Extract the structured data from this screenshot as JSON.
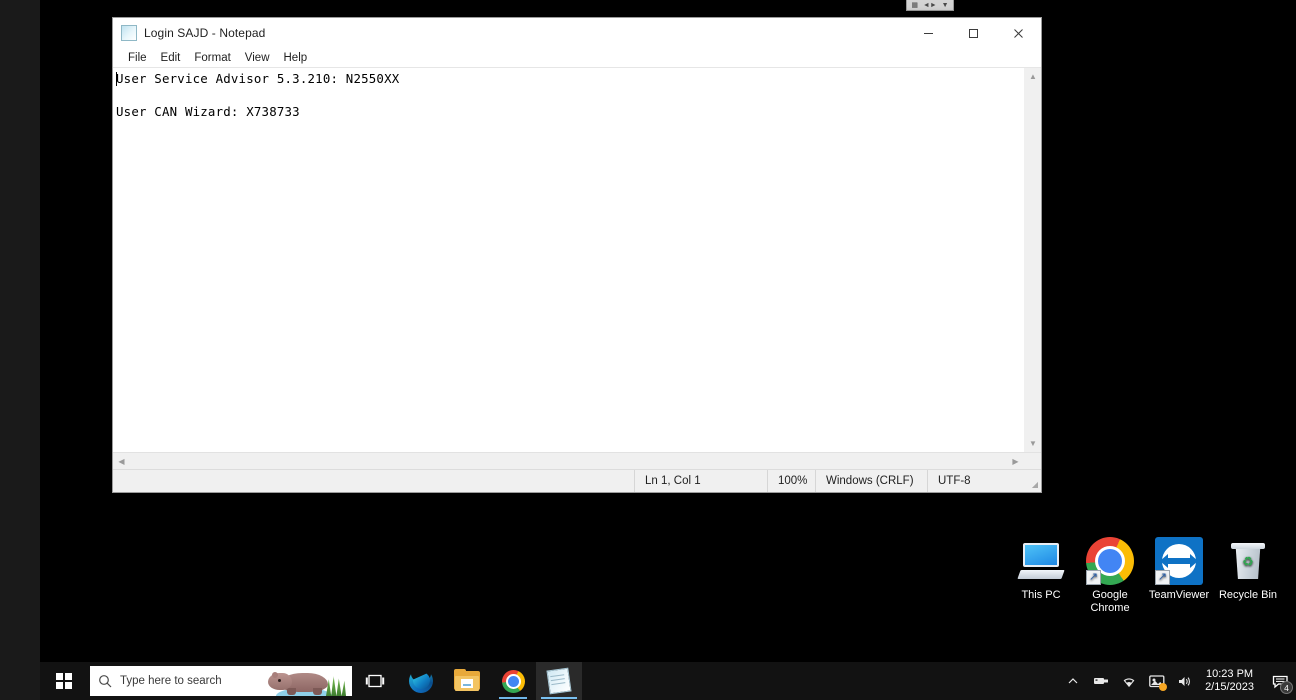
{
  "remote_toolbar": {
    "icons": [
      "grid-icon",
      "resize-icon",
      "chevron-down-icon"
    ]
  },
  "notepad": {
    "title": "Login SAJD - Notepad",
    "icon": "notepad-icon",
    "menu": [
      "File",
      "Edit",
      "Format",
      "View",
      "Help"
    ],
    "window_controls": {
      "minimize": "minimize-icon",
      "maximize": "maximize-icon",
      "close": "close-icon"
    },
    "document_lines": [
      "User Service Advisor 5.3.210: N2550XX",
      "",
      "User CAN Wizard: X738733"
    ],
    "status": {
      "cursor": "Ln 1, Col 1",
      "zoom": "100%",
      "line_ending": "Windows (CRLF)",
      "encoding": "UTF-8"
    }
  },
  "desktop": {
    "background_color": "#000000",
    "icons": [
      {
        "name": "this-pc",
        "label": "This PC"
      },
      {
        "name": "google-chrome",
        "label": "Google\nChrome",
        "label_line1": "Google",
        "label_line2": "Chrome"
      },
      {
        "name": "teamviewer",
        "label": "TeamViewer"
      },
      {
        "name": "recycle-bin",
        "label": "Recycle Bin"
      }
    ]
  },
  "taskbar": {
    "start": "windows-logo-icon",
    "search": {
      "placeholder": "Type here to search",
      "icon": "search-icon",
      "illustration": "hippo-illustration"
    },
    "task_view": "task-view-icon",
    "apps": [
      {
        "name": "microsoft-edge",
        "running": false
      },
      {
        "name": "file-explorer",
        "running": false
      },
      {
        "name": "google-chrome",
        "running": true
      },
      {
        "name": "notepad",
        "running": true,
        "active": true
      }
    ],
    "tray": {
      "icons": [
        "chevron-up-icon",
        "removable-device-icon",
        "wifi-icon",
        "display-icon",
        "volume-icon"
      ],
      "clock": {
        "time": "10:23 PM",
        "date": "2/15/2023"
      },
      "action_center": {
        "icon": "action-center-icon",
        "badge": "4"
      }
    }
  }
}
